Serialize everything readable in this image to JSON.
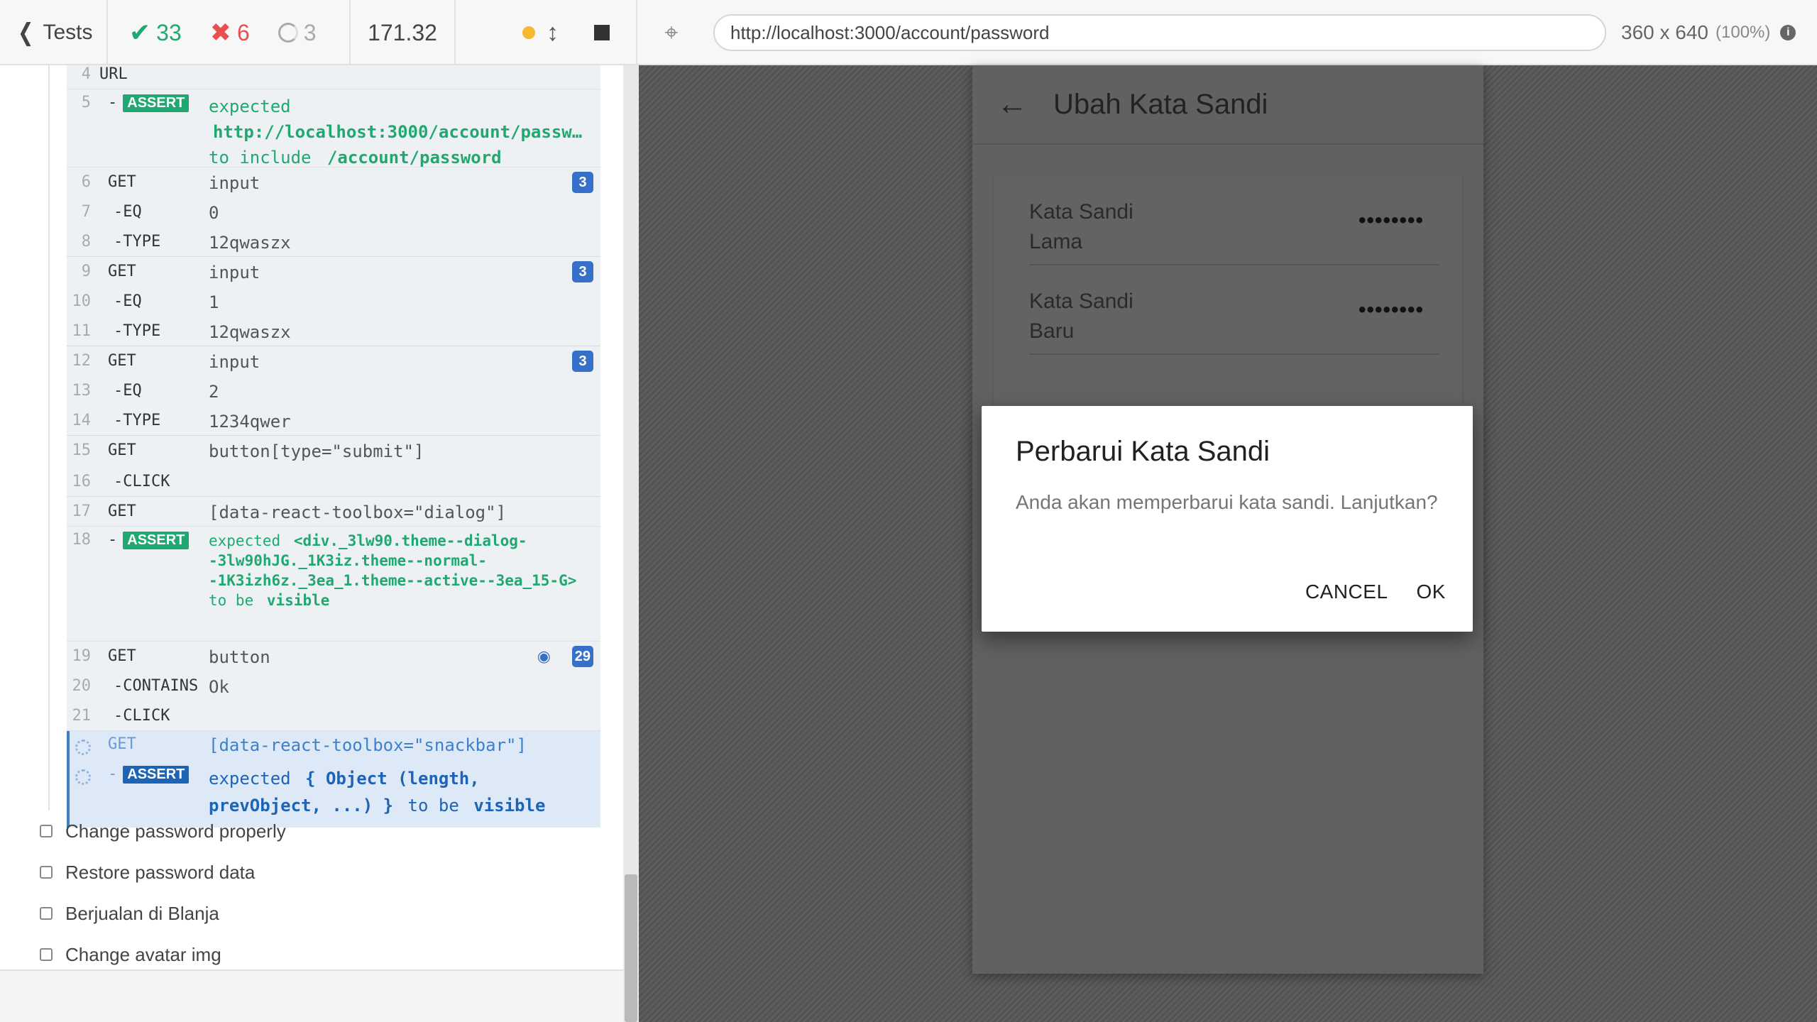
{
  "topbar": {
    "tests_label": "Tests",
    "passed": "33",
    "failed": "6",
    "pending": "3",
    "duration": "171.32",
    "url": "http://localhost:3000/account/password",
    "viewport_size": "360 x 640",
    "viewport_scale": "(100%)"
  },
  "log": {
    "rows": [
      {
        "n": "4",
        "cmd": "URL",
        "msg": ""
      },
      {
        "n": "5",
        "cmd": "-",
        "badge": "ASSERT",
        "msg_l1": "expected",
        "msg_l2": "http://localhost:3000/account/passw…",
        "msg_l3a": "to include",
        "msg_l3b": "/account/password"
      },
      {
        "n": "6",
        "cmd": "GET",
        "msg": "input",
        "count": "3"
      },
      {
        "n": "7",
        "cmd": "-EQ",
        "msg": "0"
      },
      {
        "n": "8",
        "cmd": "-TYPE",
        "msg": "12qwaszx"
      },
      {
        "n": "9",
        "cmd": "GET",
        "msg": "input",
        "count": "3"
      },
      {
        "n": "10",
        "cmd": "-EQ",
        "msg": "1"
      },
      {
        "n": "11",
        "cmd": "-TYPE",
        "msg": "12qwaszx"
      },
      {
        "n": "12",
        "cmd": "GET",
        "msg": "input",
        "count": "3"
      },
      {
        "n": "13",
        "cmd": "-EQ",
        "msg": "2"
      },
      {
        "n": "14",
        "cmd": "-TYPE",
        "msg": "1234qwer"
      },
      {
        "n": "15",
        "cmd": "GET",
        "msg": "button[type=\"submit\"]"
      },
      {
        "n": "16",
        "cmd": "-CLICK",
        "msg": ""
      },
      {
        "n": "17",
        "cmd": "GET",
        "msg": "[data-react-toolbox=\"dialog\"]"
      },
      {
        "n": "18",
        "cmd": "-",
        "badge": "ASSERT",
        "msg_l1a": "expected",
        "msg_l1b": "<div._3lw90.theme--dialog-",
        "msg_l2": "-3lw90hJG._1K3iz.theme--normal-",
        "msg_l3": "-1K3izh6z._3ea_1.theme--active--3ea_15-G>",
        "msg_l4a": "to be",
        "msg_l4b": "visible"
      },
      {
        "n": "19",
        "cmd": "GET",
        "msg": "button",
        "count": "29"
      },
      {
        "n": "20",
        "cmd": "-CONTAINS",
        "msg": "Ok"
      },
      {
        "n": "21",
        "cmd": "-CLICK",
        "msg": ""
      }
    ],
    "pending_get": {
      "cmd": "GET",
      "msg": "[data-react-toolbox=\"snackbar\"]"
    },
    "pending_assert": {
      "badge": "ASSERT",
      "l1a": "expected",
      "l1b": "{ Object (length,",
      "l2a": "prevObject, ...) }",
      "l2b": "to be",
      "l2c": "visible"
    }
  },
  "tests": [
    "Change password properly",
    "Restore password data",
    "Berjualan di Blanja",
    "Change avatar img"
  ],
  "app": {
    "title": "Ubah Kata Sandi",
    "field_old_label_1": "Kata Sandi",
    "field_old_label_2": "Lama",
    "field_new_label_1": "Kata Sandi",
    "field_new_label_2": "Baru",
    "masked": "••••••••"
  },
  "dialog": {
    "title": "Perbarui Kata Sandi",
    "text": "Anda akan memperbarui kata sandi. Lanjutkan?",
    "cancel": "CANCEL",
    "ok": "OK"
  },
  "colors": {
    "pass": "#1fa971",
    "fail": "#e94f4f",
    "count_badge": "#3770c8",
    "pending": "#3f80c9"
  }
}
